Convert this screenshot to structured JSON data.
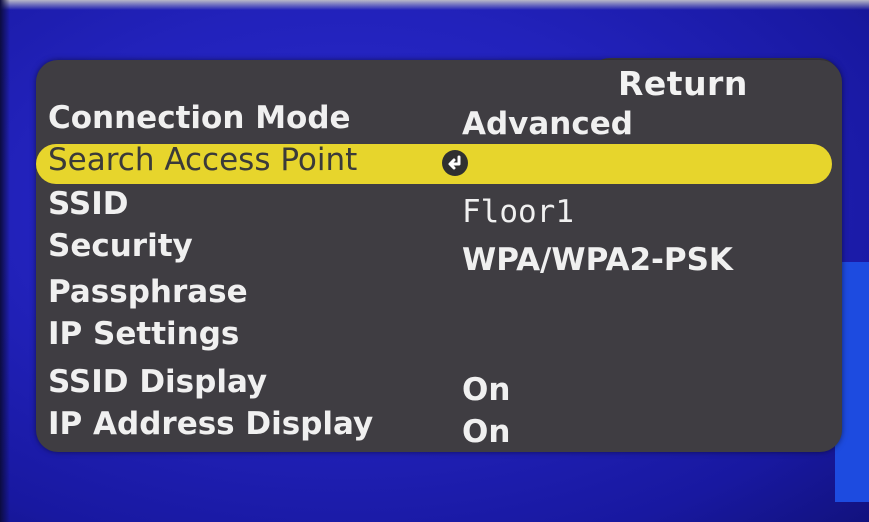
{
  "menu": {
    "return_label": "Return",
    "rows": [
      {
        "label": "Connection Mode",
        "value": "Advanced"
      },
      {
        "label": "Search Access Point",
        "value": ""
      },
      {
        "label": "SSID",
        "value": "Floor1"
      },
      {
        "label": "Security",
        "value": "WPA/WPA2-PSK"
      },
      {
        "label": "Passphrase",
        "value": ""
      },
      {
        "label": "IP Settings",
        "value": ""
      },
      {
        "label": "SSID Display",
        "value": "On"
      },
      {
        "label": "IP Address Display",
        "value": "On"
      }
    ],
    "selected_index": 1,
    "selected_icon": "enter-icon"
  },
  "colors": {
    "background": "#2222bb",
    "panel": "#3f3d42",
    "highlight": "#e7d52c",
    "text": "#f0f0f0"
  }
}
